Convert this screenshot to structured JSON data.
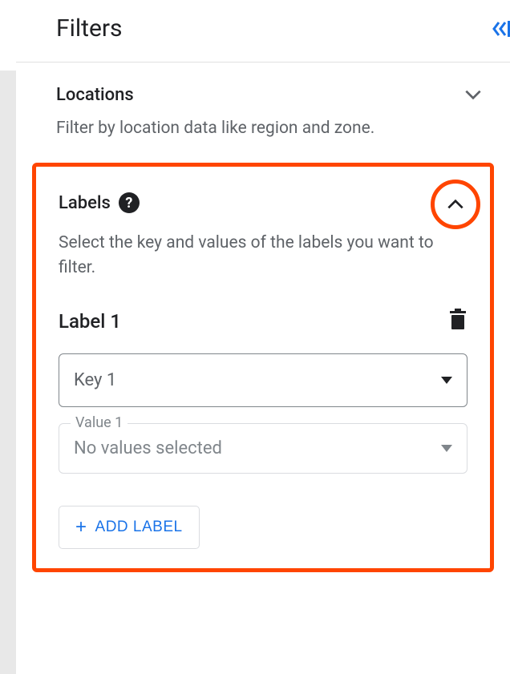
{
  "header": {
    "title": "Filters"
  },
  "sections": {
    "locations": {
      "title": "Locations",
      "description": "Filter by location data like region and zone."
    },
    "labels": {
      "title": "Labels",
      "description": "Select the key and values of the labels you want to filter.",
      "label_item": {
        "name": "Label 1",
        "key_placeholder": "Key 1",
        "value_label": "Value 1",
        "value_placeholder": "No values selected"
      },
      "add_button": "ADD LABEL"
    }
  }
}
